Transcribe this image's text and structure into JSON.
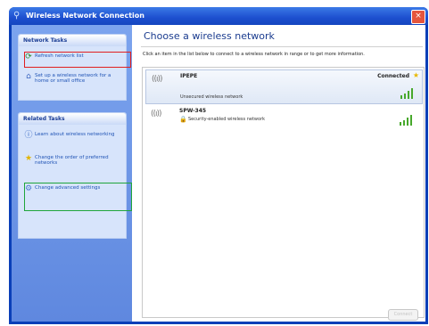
{
  "window": {
    "title": "Wireless Network Connection",
    "close": "×",
    "icon": "wireless-icon"
  },
  "sidebar": {
    "network_tasks": {
      "title": "Network Tasks",
      "items": [
        {
          "label": "Refresh network list",
          "icon": "refresh-icon"
        },
        {
          "label": "Set up a wireless network for a home or small office",
          "icon": "setup-icon"
        }
      ]
    },
    "related_tasks": {
      "title": "Related Tasks",
      "items": [
        {
          "label": "Learn about wireless networking",
          "icon": "info-icon"
        },
        {
          "label": "Change the order of preferred networks",
          "icon": "star-icon"
        },
        {
          "label": "Change advanced settings",
          "icon": "settings-icon"
        }
      ]
    }
  },
  "main": {
    "heading": "Choose a wireless network",
    "instructions": "Click an item in the list below to connect to a wireless network in range or to get more information.",
    "networks": [
      {
        "name": "IPEPE",
        "status": "Connected",
        "description": "Unsecured wireless network",
        "signal_bars": 4
      },
      {
        "name": "SPW-345",
        "status": "",
        "description": "Security-enabled wireless network",
        "signal_bars": 4
      }
    ],
    "connect_button": "Connect"
  },
  "colors": {
    "titlebar": "#1d4fcf",
    "sidebar": "#6e97e6",
    "heading": "#1b3c8f",
    "signal": "#47a82c",
    "highlight_red": "#e02020",
    "highlight_green": "#1fa53b"
  }
}
